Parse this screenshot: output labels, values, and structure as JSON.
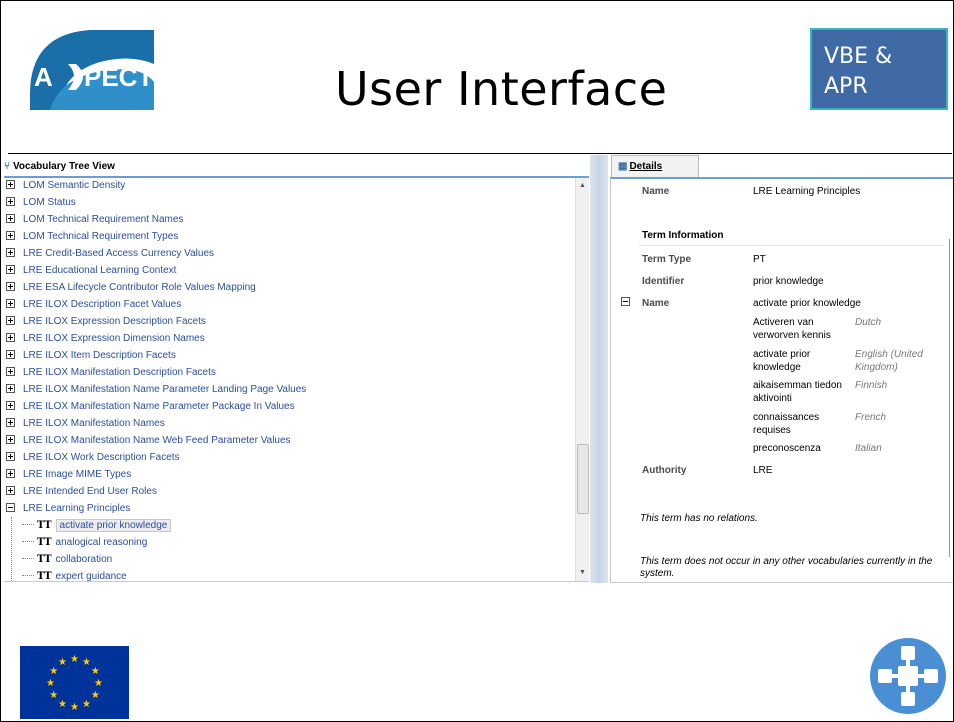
{
  "slide": {
    "title": "User Interface",
    "logo_text": {
      "a": "A",
      "rest": "PECT"
    },
    "badge_line1": "VBE &",
    "badge_line2": "APR"
  },
  "colors": {
    "link": "#2a4fa0",
    "accent": "#6b9cd3",
    "badge": "#3f6aa5",
    "eu_blue": "#003399",
    "star": "#ffcc00"
  },
  "tree_panel": {
    "heading": "Vocabulary Tree View",
    "heading_icon": "tree-icon",
    "items": [
      "LOM Semantic Density",
      "LOM Status",
      "LOM Technical Requirement Names",
      "LOM Technical Requirement Types",
      "LRE Credit-Based Access Currency Values",
      "LRE Educational Learning Context",
      "LRE ESA Lifecycle Contributor Role Values Mapping",
      "LRE ILOX Description Facet Values",
      "LRE ILOX Expression Description Facets",
      "LRE ILOX Expression Dimension Names",
      "LRE ILOX Item Description Facets",
      "LRE ILOX Manifestation Description Facets",
      "LRE ILOX Manifestation Name Parameter Landing Page Values",
      "LRE ILOX Manifestation Name Parameter Package In Values",
      "LRE ILOX Manifestation Names",
      "LRE ILOX Manifestation Name Web Feed Parameter Values",
      "LRE ILOX Work Description Facets",
      "LRE Image MIME Types",
      "LRE Intended End User Roles",
      "LRE Learning Principles"
    ],
    "children_symbol": "TT",
    "children": [
      "activate prior knowledge",
      "analogical reasoning",
      "collaboration",
      "expert guidance"
    ]
  },
  "details": {
    "tab_label": "Details",
    "tab_icon": "details-icon",
    "name_label": "Name",
    "name_value": "LRE Learning Principles",
    "section_title": "Term Information",
    "term_type_label": "Term Type",
    "term_type_value": "PT",
    "identifier_label": "Identifier",
    "identifier_value": "prior knowledge",
    "term_name_label": "Name",
    "term_name_value": "activate prior knowledge",
    "translations": [
      {
        "text": "Activeren van verworven kennis",
        "lang": "Dutch"
      },
      {
        "text": "activate prior knowledge",
        "lang": "English (United Kingdom)"
      },
      {
        "text": "aikaisemman tiedon aktivointi",
        "lang": "Finnish"
      },
      {
        "text": "connaissances requises",
        "lang": "French"
      },
      {
        "text": "preconoscenza",
        "lang": "Italian"
      }
    ],
    "authority_label": "Authority",
    "authority_value": "LRE",
    "no_relations": "This term has no relations.",
    "no_other_vocab": "This term does not occur in any other vocabularies currently in the system."
  }
}
